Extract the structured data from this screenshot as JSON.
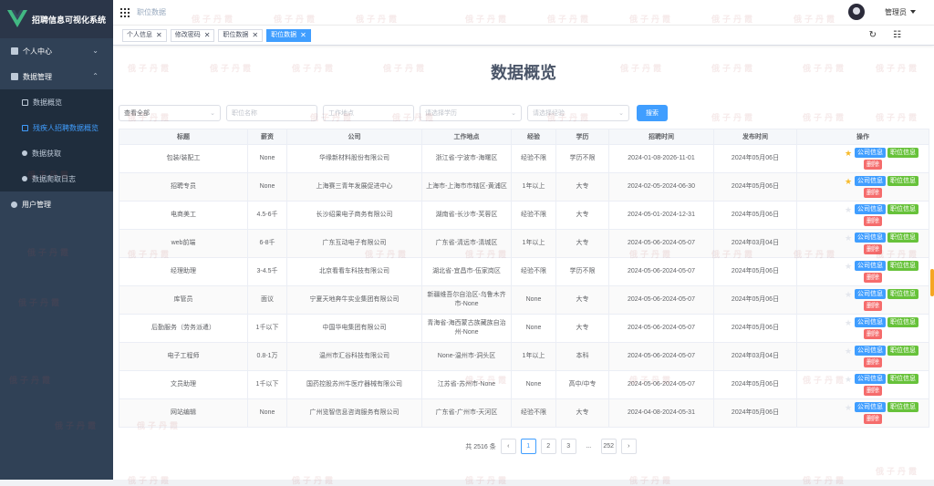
{
  "app": {
    "title": "招聘信息可视化系统"
  },
  "sidebar": {
    "items": [
      {
        "label": "个人中心"
      },
      {
        "label": "数据管理"
      },
      {
        "label": "用户管理"
      }
    ],
    "sub_items": [
      {
        "label": "数据概览"
      },
      {
        "label": "残疾人招聘数据概览"
      },
      {
        "label": "数据获取"
      },
      {
        "label": "数据爬取日志"
      }
    ]
  },
  "navbar": {
    "breadcrumb": "职位数据",
    "user": "管理员"
  },
  "tags": [
    {
      "label": "个人信息"
    },
    {
      "label": "修改密码"
    },
    {
      "label": "职位数据"
    },
    {
      "label": "职位数据"
    }
  ],
  "page": {
    "title": "数据概览"
  },
  "filters": {
    "view_all": "查看全部",
    "job_name_placeholder": "职位名称",
    "location_placeholder": "工作地点",
    "education_placeholder": "请选择学历",
    "experience_placeholder": "请选择经验",
    "search_button": "搜索"
  },
  "table": {
    "headers": [
      "标题",
      "薪资",
      "公司",
      "工作地点",
      "经验",
      "学历",
      "招聘时间",
      "发布时间",
      "操作"
    ],
    "buttons": {
      "company": "公司信息",
      "job": "职位信息",
      "delete": "删除"
    },
    "rows": [
      {
        "title": "包装/装配工",
        "salary": "None",
        "company": "华缘新材料股份有限公司",
        "location": "浙江省-宁波市-海曙区",
        "exp": "经验不限",
        "edu": "学历不限",
        "period": "2024-01-08-2026-11-01",
        "date": "2024年05月06日",
        "star": true
      },
      {
        "title": "招聘专员",
        "salary": "None",
        "company": "上海赛三青年发展促进中心",
        "location": "上海市-上海市市辖区-黄浦区",
        "exp": "1年以上",
        "edu": "大专",
        "period": "2024-02-05-2024-06-30",
        "date": "2024年05月06日",
        "star": true
      },
      {
        "title": "电商美工",
        "salary": "4.5-6千",
        "company": "长沙绍果电子商务有限公司",
        "location": "湖南省-长沙市-芙蓉区",
        "exp": "经验不限",
        "edu": "大专",
        "period": "2024-05-01-2024-12-31",
        "date": "2024年05月06日",
        "star": false
      },
      {
        "title": "web前端",
        "salary": "6-8千",
        "company": "广东互动电子有限公司",
        "location": "广东省-清远市-清城区",
        "exp": "1年以上",
        "edu": "大专",
        "period": "2024-05-06-2024-05-07",
        "date": "2024年03月04日",
        "star": false
      },
      {
        "title": "经理助理",
        "salary": "3-4.5千",
        "company": "北京看看车科技有限公司",
        "location": "湖北省-宜昌市-伍家岗区",
        "exp": "经验不限",
        "edu": "学历不限",
        "period": "2024-05-06-2024-05-07",
        "date": "2024年05月06日",
        "star": false
      },
      {
        "title": "库管员",
        "salary": "面议",
        "company": "宁夏天地奔牛实业集团有限公司",
        "location": "新疆维吾尔自治区-乌鲁木齐市-None",
        "exp": "None",
        "edu": "大专",
        "period": "2024-05-06-2024-05-07",
        "date": "2024年05月06日",
        "star": false
      },
      {
        "title": "后勤服务（劳务派遣）",
        "salary": "1千以下",
        "company": "中国华电集团有限公司",
        "location": "青海省-海西蒙古族藏族自治州-None",
        "exp": "None",
        "edu": "大专",
        "period": "2024-05-06-2024-05-07",
        "date": "2024年05月06日",
        "star": false
      },
      {
        "title": "电子工程师",
        "salary": "0.8-1万",
        "company": "温州市汇谷科技有限公司",
        "location": "None-温州市-洞头区",
        "exp": "1年以上",
        "edu": "本科",
        "period": "2024-05-06-2024-05-07",
        "date": "2024年03月04日",
        "star": false
      },
      {
        "title": "文员助理",
        "salary": "1千以下",
        "company": "国药控股苏州牛医疗器械有限公司",
        "location": "江苏省-苏州市-None",
        "exp": "None",
        "edu": "高中/中专",
        "period": "2024-05-06-2024-05-07",
        "date": "2024年05月06日",
        "star": false
      },
      {
        "title": "网站编辑",
        "salary": "None",
        "company": "广州览智信息咨询服务有限公司",
        "location": "广东省-广州市-天河区",
        "exp": "经验不限",
        "edu": "大专",
        "period": "2024-04-08-2024-05-31",
        "date": "2024年05月06日",
        "star": false
      }
    ]
  },
  "pagination": {
    "total": "共 2516 条",
    "pages": [
      "1",
      "2",
      "3",
      "...",
      "252"
    ],
    "prev": "‹",
    "next": "›"
  },
  "watermark": "俄子丹霞",
  "colors": {
    "sidebar": "#304156",
    "accent": "#409eff",
    "success": "#67c23a",
    "danger": "#f56c6c",
    "star": "#f7ba2a"
  }
}
